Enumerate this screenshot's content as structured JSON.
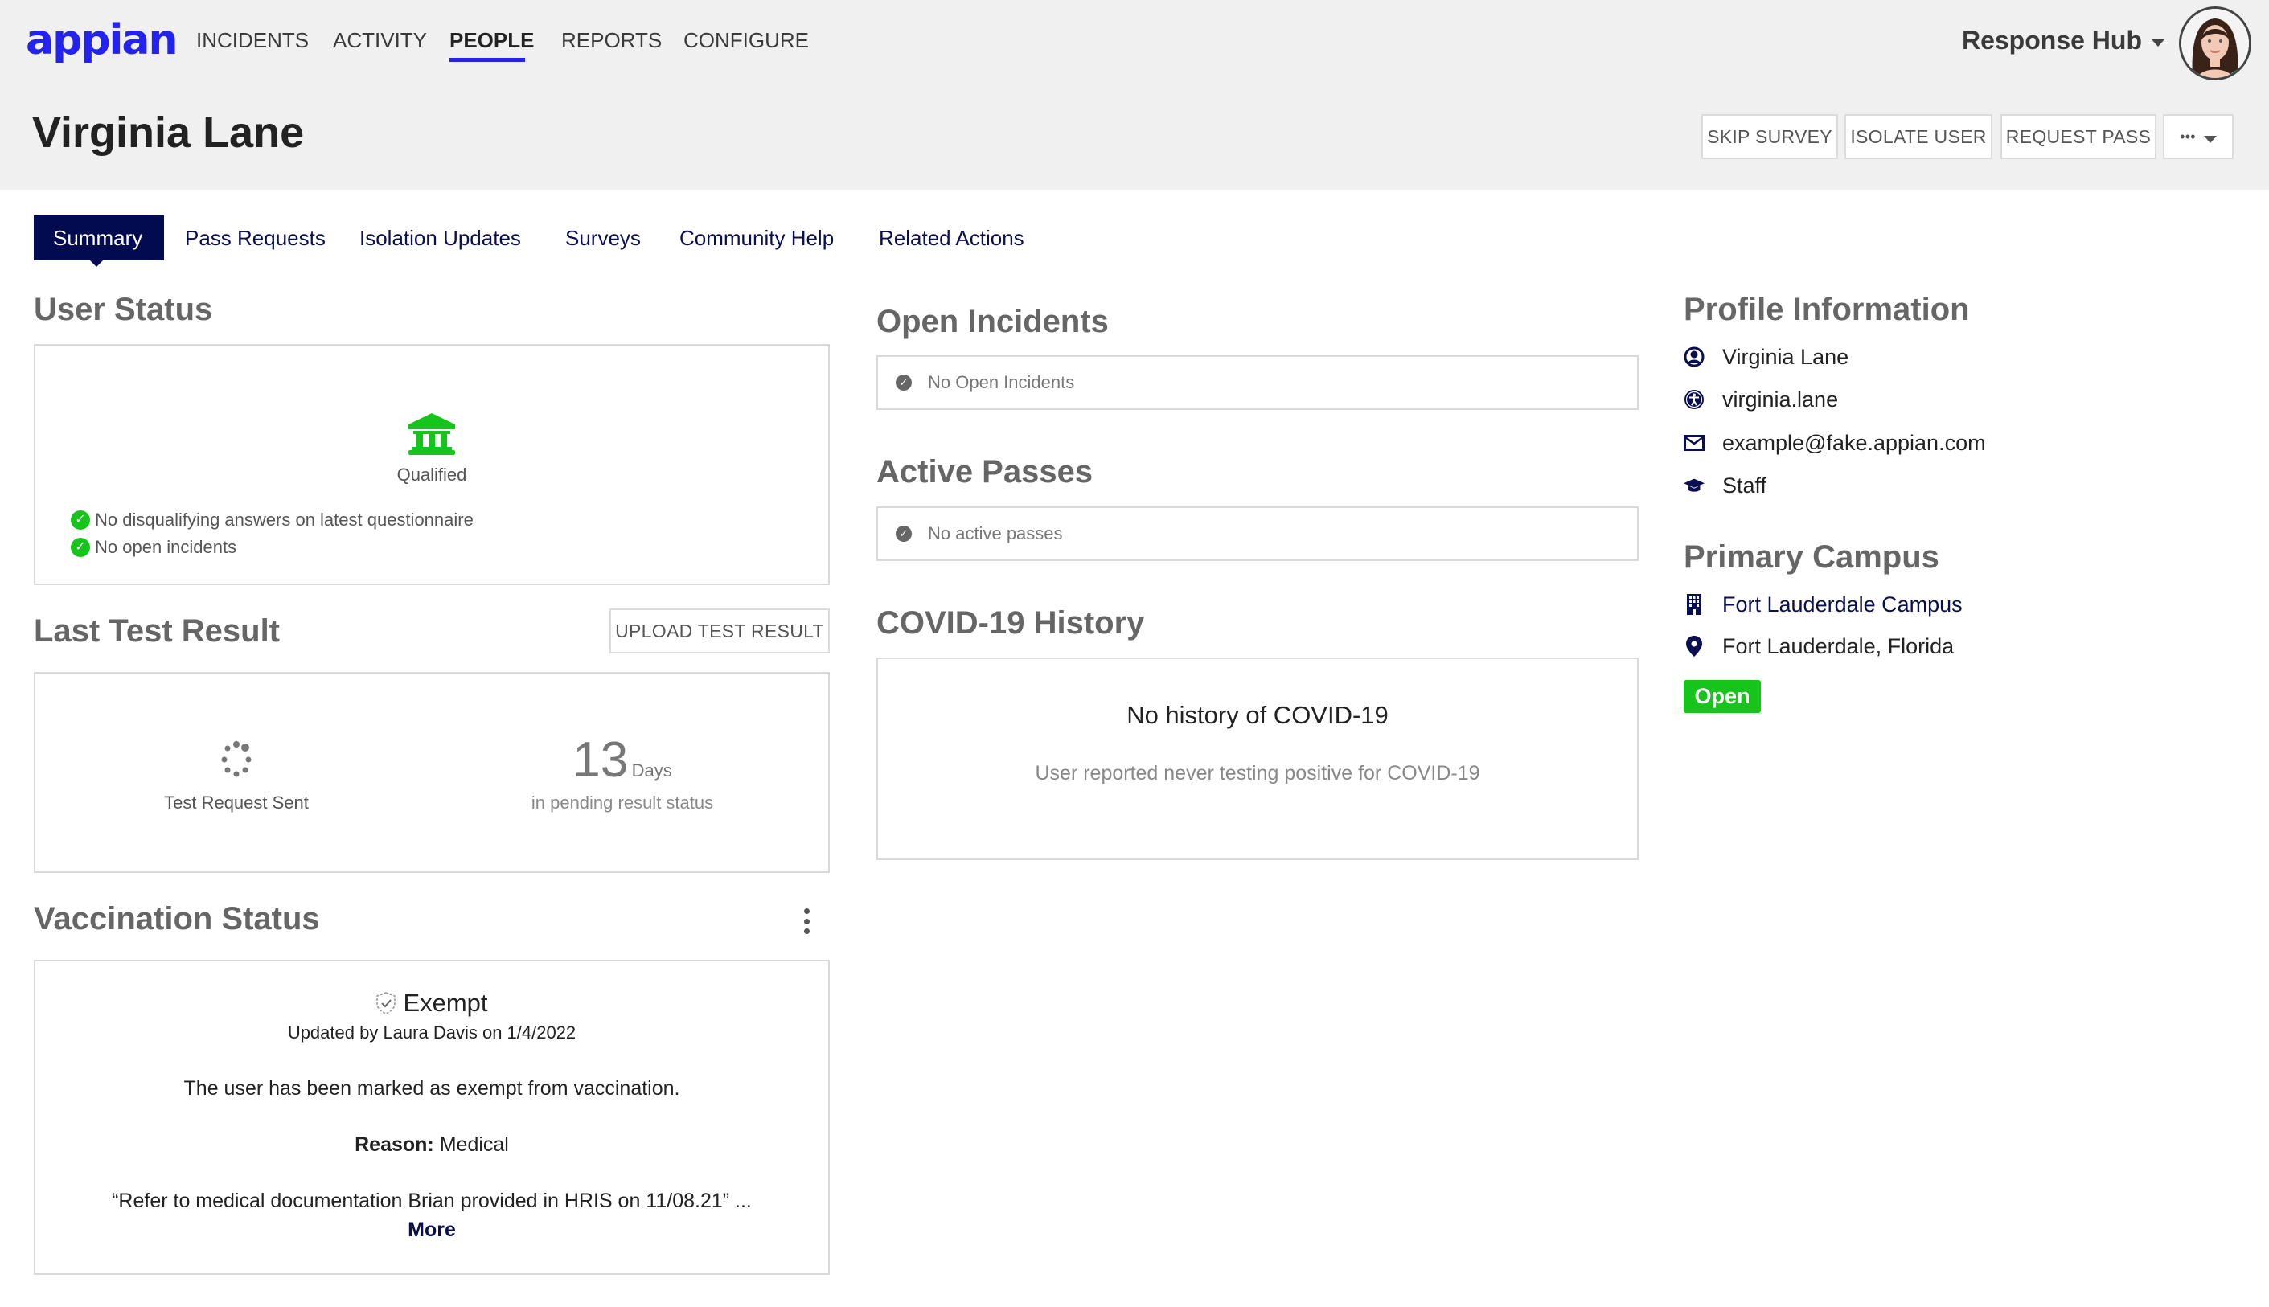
{
  "app": {
    "logo_text": "appian",
    "app_switcher_label": "Response Hub",
    "brand_color": "#2322f0",
    "nav_color": "#020b4f",
    "success_color": "#17c41b"
  },
  "nav": {
    "items": [
      {
        "label": "INCIDENTS",
        "active": false
      },
      {
        "label": "ACTIVITY",
        "active": false
      },
      {
        "label": "PEOPLE",
        "active": true
      },
      {
        "label": "REPORTS",
        "active": false
      },
      {
        "label": "CONFIGURE",
        "active": false
      }
    ]
  },
  "header": {
    "title": "Virginia Lane",
    "actions": {
      "skip_survey": "SKIP SURVEY",
      "isolate_user": "ISOLATE USER",
      "request_pass": "REQUEST PASS",
      "more": "•••"
    }
  },
  "tabs": [
    {
      "label": "Summary",
      "active": true
    },
    {
      "label": "Pass Requests",
      "active": false
    },
    {
      "label": "Isolation Updates",
      "active": false
    },
    {
      "label": "Surveys",
      "active": false
    },
    {
      "label": "Community Help",
      "active": false
    },
    {
      "label": "Related Actions",
      "active": false
    }
  ],
  "user_status": {
    "heading": "User Status",
    "icon": "bank-icon",
    "status": "Qualified",
    "checks": [
      "No disqualifying answers on latest questionnaire",
      "No open incidents"
    ]
  },
  "last_test": {
    "heading": "Last Test Result",
    "upload_button": "UPLOAD TEST RESULT",
    "status": "Test Request Sent",
    "days_value": "13",
    "days_unit": "Days",
    "days_caption": "in pending result status"
  },
  "vaccination": {
    "heading": "Vaccination Status",
    "status": "Exempt",
    "updated": "Updated by Laura Davis on 1/4/2022",
    "message": "The user has been marked as exempt from vaccination.",
    "reason_label": "Reason:",
    "reason_value": "Medical",
    "note": "“Refer to medical documentation Brian provided in HRIS on 11/08.21” ...",
    "more_link": "More"
  },
  "open_incidents": {
    "heading": "Open Incidents",
    "empty_text": "No Open Incidents"
  },
  "active_passes": {
    "heading": "Active Passes",
    "empty_text": "No active passes"
  },
  "covid_history": {
    "heading": "COVID-19 History",
    "title": "No history of COVID-19",
    "subtitle": "User reported never testing positive for COVID-19"
  },
  "profile": {
    "heading": "Profile Information",
    "name": "Virginia Lane",
    "username": "virginia.lane",
    "email": "example@fake.appian.com",
    "role": "Staff"
  },
  "campus": {
    "heading": "Primary Campus",
    "name": "Fort Lauderdale Campus",
    "location": "Fort Lauderdale, Florida",
    "status": "Open"
  }
}
